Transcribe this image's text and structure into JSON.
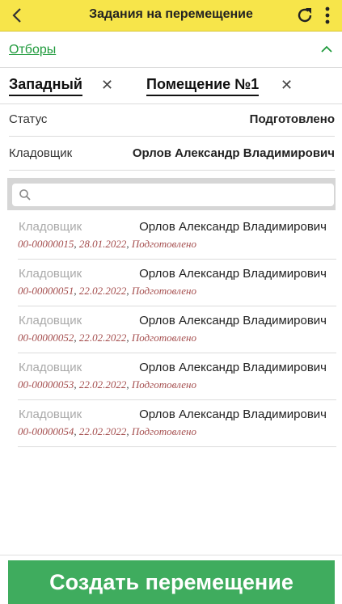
{
  "header": {
    "title": "Задания на перемещение",
    "colors": {
      "bar": "#f7e54a",
      "accent": "#1f9a3c"
    }
  },
  "filters": {
    "label": "Отборы",
    "chips": [
      {
        "label": "Западный",
        "remove": "✕"
      },
      {
        "label": "Помещение №1",
        "remove": "✕"
      }
    ]
  },
  "status_row": {
    "label": "Статус",
    "value": "Подготовлено"
  },
  "keeper_row": {
    "label": "Кладовщик",
    "value": "Орлов Александр Владимирович"
  },
  "search": {
    "placeholder": ""
  },
  "list": {
    "items": [
      {
        "label": "Кладовщик",
        "value": "Орлов Александр Владимирович",
        "number": "00-00000015",
        "date": "28.01.2022",
        "status": "Подготовлено"
      },
      {
        "label": "Кладовщик",
        "value": "Орлов Александр Владимирович",
        "number": "00-00000051",
        "date": "22.02.2022",
        "status": "Подготовлено"
      },
      {
        "label": "Кладовщик",
        "value": "Орлов Александр Владимирович",
        "number": "00-00000052",
        "date": "22.02.2022",
        "status": "Подготовлено"
      },
      {
        "label": "Кладовщик",
        "value": "Орлов Александр Владимирович",
        "number": "00-00000053",
        "date": "22.02.2022",
        "status": "Подготовлено"
      },
      {
        "label": "Кладовщик",
        "value": "Орлов Александр Владимирович",
        "number": "00-00000054",
        "date": "22.02.2022",
        "status": "Подготовлено"
      }
    ],
    "separator": ", "
  },
  "footer": {
    "create_label": "Создать перемещение",
    "button_color": "#3fac5e"
  }
}
